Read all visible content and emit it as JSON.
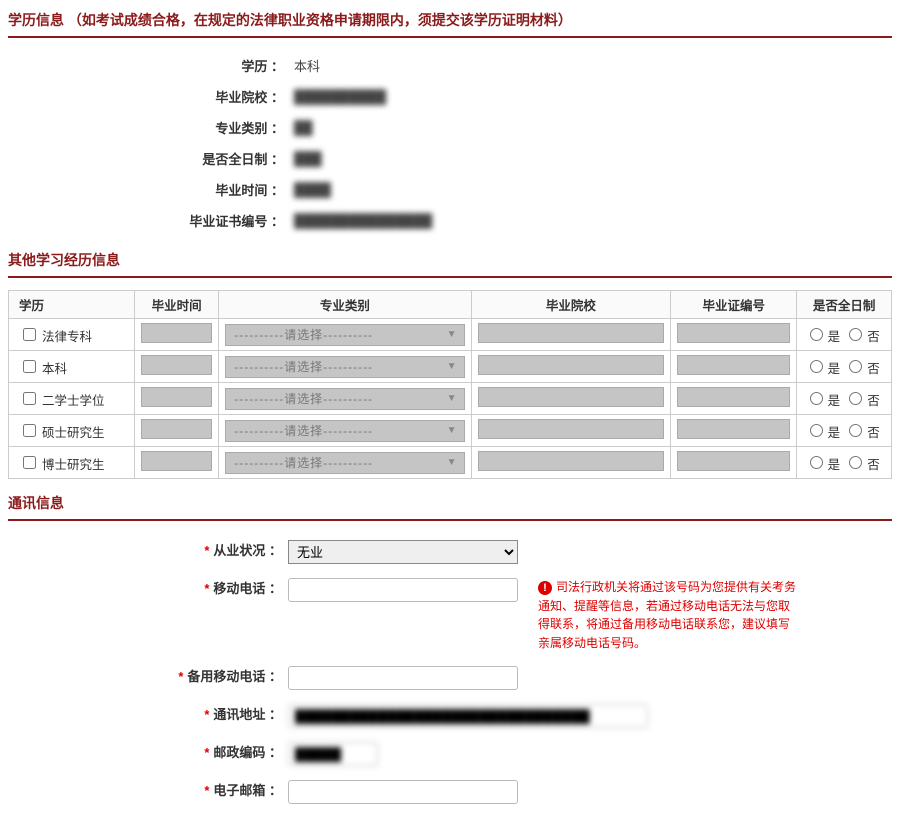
{
  "sections": {
    "education_title": "学历信息 （如考试成绩合格，在规定的法律职业资格申请期限内，须提交该学历证明材料）",
    "other_edu_title": "其他学习经历信息",
    "contact_title": "通讯信息"
  },
  "education": {
    "labels": {
      "degree": "学历 ：",
      "school": "毕业院校 ：",
      "major": "专业类别 ：",
      "fulltime": "是否全日制 ：",
      "gradtime": "毕业时间 ：",
      "certno": "毕业证书编号 ："
    },
    "values": {
      "degree": "本科",
      "school": "██████████",
      "major": "██",
      "fulltime": "███",
      "gradtime": "████",
      "certno": "███████████████"
    }
  },
  "other_edu": {
    "headers": {
      "degree": "学历",
      "gradtime": "毕业时间",
      "major": "专业类别",
      "school": "毕业院校",
      "certno": "毕业证编号",
      "fulltime": "是否全日制"
    },
    "select_placeholder": "----------请选择----------",
    "yes": "是",
    "no": "否",
    "rows": [
      {
        "label": "法律专科"
      },
      {
        "label": "本科"
      },
      {
        "label": "二学士学位"
      },
      {
        "label": "硕士研究生"
      },
      {
        "label": "博士研究生"
      }
    ]
  },
  "contact": {
    "labels": {
      "status": "从业状况 ：",
      "mobile": "移动电话 ：",
      "backup_mobile": "备用移动电话 ：",
      "address": "通讯地址 ：",
      "postcode": "邮政编码 ：",
      "email": "电子邮箱 ："
    },
    "values": {
      "status": "无业",
      "mobile": "",
      "backup_mobile": "",
      "address": "████████████████████████████████",
      "postcode": "█████",
      "email": ""
    },
    "note": "司法行政机关将通过该号码为您提供有关考务通知、提醒等信息，若通过移动电话无法与您取得联系，将通过备用移动电话联系您，建议填写亲属移动电话号码。"
  }
}
